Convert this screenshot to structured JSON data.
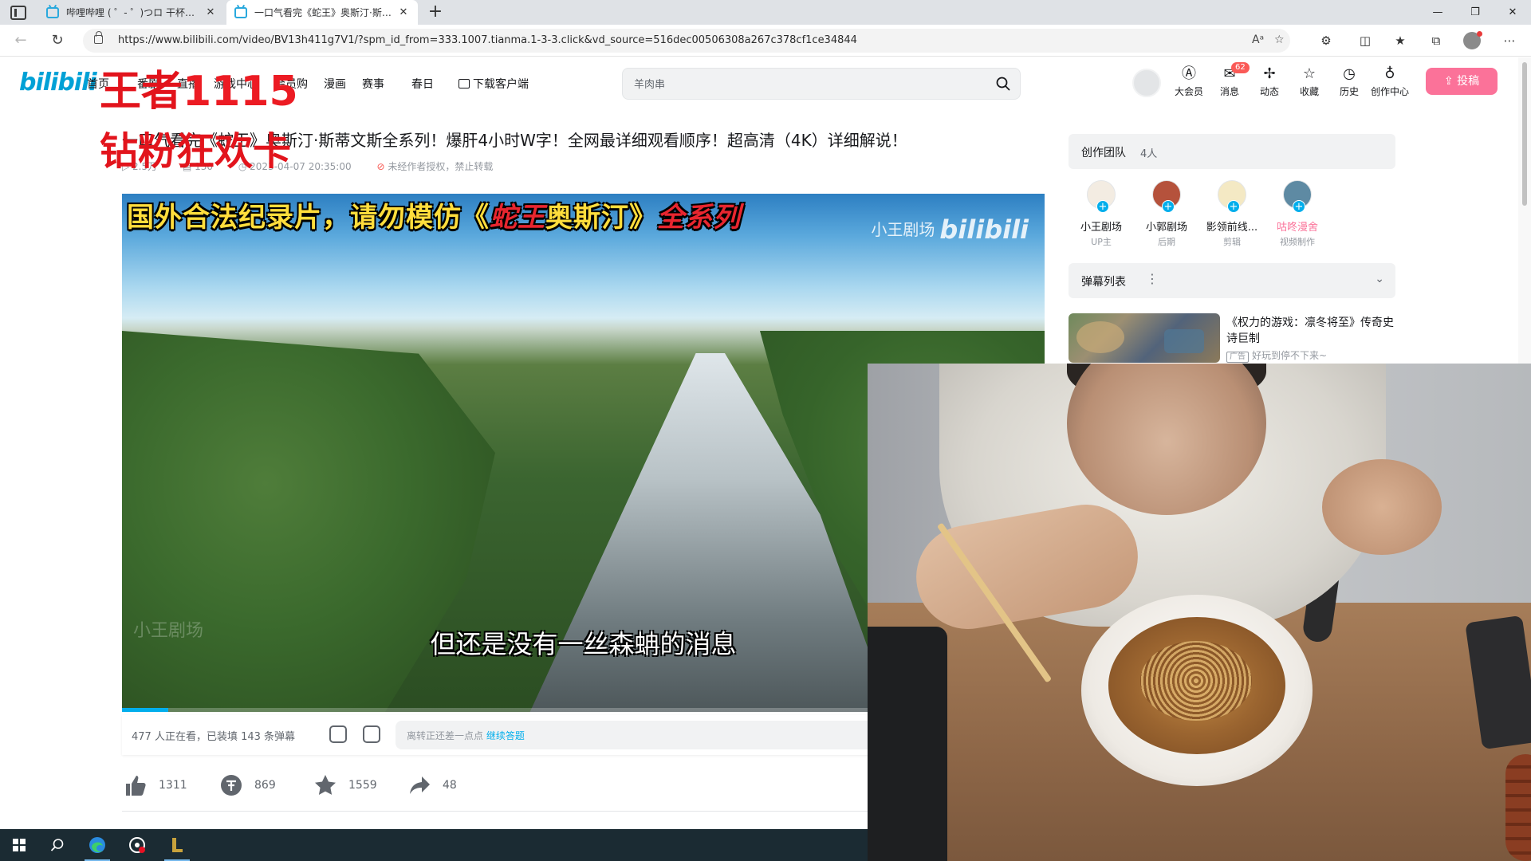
{
  "browser": {
    "tabs": [
      {
        "title": "哔哩哔哩 ( ゜- ゜)つロ 干杯~-bilibili",
        "active": false
      },
      {
        "title": "一口气看完《蛇王》奥斯汀·斯蒂文斯全系列！",
        "active": true
      }
    ],
    "url": "https://www.bilibili.com/video/BV13h411g7V1/?spm_id_from=333.1007.tianma.1-3-3.click&vd_source=516dec00506308a267c378cf1ce34844"
  },
  "header": {
    "logo": "bilibili",
    "nav": [
      "首页",
      "番剧",
      "直播",
      "游戏中心",
      "会员购",
      "漫画",
      "赛事",
      "春日"
    ],
    "download": "下载客户端",
    "search_placeholder": "羊肉串",
    "entries": [
      {
        "label": "大会员",
        "icon": "vip-icon"
      },
      {
        "label": "消息",
        "icon": "message-icon",
        "badge": "62"
      },
      {
        "label": "动态",
        "icon": "dynamic-icon"
      },
      {
        "label": "收藏",
        "icon": "star-icon"
      },
      {
        "label": "历史",
        "icon": "clock-icon"
      },
      {
        "label": "创作中心",
        "icon": "bulb-icon"
      }
    ],
    "upload": "投稿"
  },
  "video": {
    "title": "一口气看完《蛇王》奥斯汀·斯蒂文斯全系列！爆肝4小时W字！全网最详细观看顺序！超高清（4K）详细解说！",
    "views": "2.5万",
    "danmaku_count": "130",
    "date": "2023-04-07 20:35:00",
    "copyright": "未经作者授权，禁止转载",
    "banner_yellow_1": "国外合法纪录片，请勿模仿《",
    "banner_red_1": "蛇王",
    "banner_yellow_2": "奥斯汀》",
    "banner_red_2": "全系列",
    "watermark": "小王剧场",
    "watermark_logo": "bilibili",
    "subtitle": "但还是没有一丝森蚺的消息",
    "progress": 0.05,
    "bottom_watermark": "小王剧场"
  },
  "danmaku_bar": {
    "status": "477 人正在看，已装填 143 条弹幕",
    "input_hint": "离转正还差一点点",
    "input_link": "继续答题"
  },
  "actions": [
    {
      "name": "like",
      "value": "1311"
    },
    {
      "name": "coin",
      "value": "869"
    },
    {
      "name": "favorite",
      "value": "1559"
    },
    {
      "name": "share",
      "value": "48"
    }
  ],
  "sidebar": {
    "team_title": "创作团队",
    "team_count": "4人",
    "members": [
      {
        "name": "小王剧场",
        "role": "UP主",
        "pink": false
      },
      {
        "name": "小郭剧场",
        "role": "后期",
        "pink": false
      },
      {
        "name": "影领前线...",
        "role": "剪辑",
        "pink": false
      },
      {
        "name": "咕咚漫舍",
        "role": "视频制作",
        "pink": true
      }
    ],
    "danmaku_list": "弹幕列表",
    "ad_title": "《权力的游戏：凛冬将至》传奇史诗巨制",
    "ad_tag": "广告",
    "ad_sub": "好玩到停不下来~"
  },
  "overlay": {
    "line1_prefix": "王者",
    "line1_num": "1115",
    "line2": "钻粉狂欢卡"
  },
  "colors": {
    "bili_blue": "#00a1d6",
    "bili_pink": "#fb7299",
    "overlay_red": "#e2141c"
  }
}
